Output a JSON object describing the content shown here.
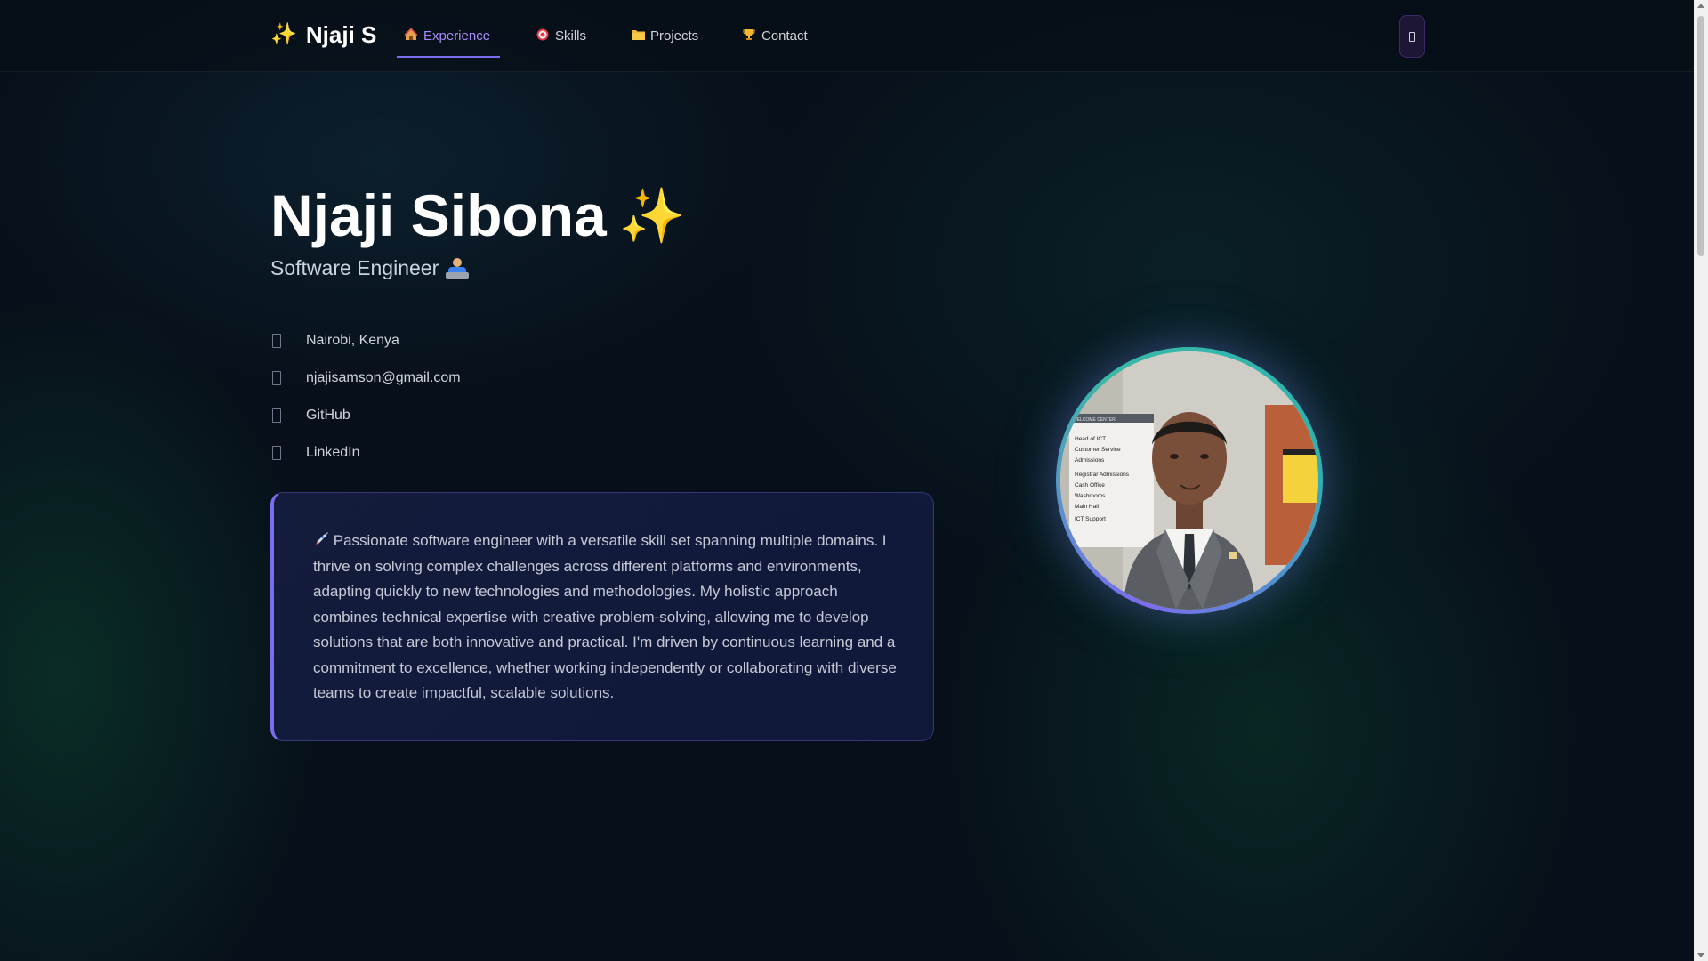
{
  "nav": {
    "brand": "Njaji S",
    "brand_icon": "sparkles-icon",
    "items": [
      {
        "label": "Experience",
        "icon": "house-icon",
        "active": true
      },
      {
        "label": "Skills",
        "icon": "target-icon",
        "active": false
      },
      {
        "label": "Projects",
        "icon": "folder-icon",
        "active": false
      },
      {
        "label": "Contact",
        "icon": "trophy-icon",
        "active": false
      }
    ],
    "theme_toggle_icon": "moon-icon"
  },
  "hero": {
    "name": "Njaji Sibona",
    "name_icon": "sparkles-icon",
    "role": "Software Engineer",
    "role_icon": "technologist-icon",
    "contacts": [
      {
        "label": "Nairobi, Kenya",
        "icon": "location-icon"
      },
      {
        "label": "njajisamson@gmail.com",
        "icon": "email-icon"
      },
      {
        "label": "GitHub",
        "icon": "github-icon"
      },
      {
        "label": "LinkedIn",
        "icon": "linkedin-icon"
      }
    ],
    "bio": "Passionate software engineer with a versatile skill set spanning multiple domains. I thrive on solving complex challenges across different platforms and environments, adapting quickly to new technologies and methodologies. My holistic approach combines technical expertise with creative problem-solving, allowing me to develop solutions that are both innovative and practical. I'm driven by continuous learning and a commitment to excellence, whether working independently or collaborating with diverse teams to create impactful, scalable solutions.",
    "bio_icon": "rocket-icon",
    "photo_sign_lines": [
      "WELCOME CENTER",
      "Head of ICT",
      "Customer Service",
      "Admissions",
      "Registrar Admissions",
      "Cash Office",
      "Washrooms",
      "Main Hall",
      "ICT Support"
    ]
  },
  "colors": {
    "accent": "#7c6cf0",
    "teal": "#2bb3b0",
    "background": "#07101a"
  }
}
